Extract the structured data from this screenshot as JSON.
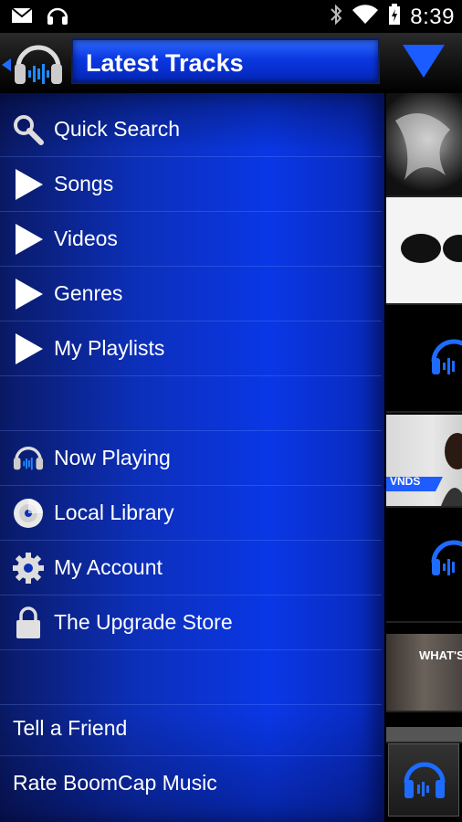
{
  "status_bar": {
    "time": "8:39"
  },
  "action_bar": {
    "title": "Latest Tracks"
  },
  "menu": {
    "items": [
      {
        "label": "Quick Search",
        "icon": "search-icon"
      },
      {
        "label": "Songs",
        "icon": "play-icon"
      },
      {
        "label": "Videos",
        "icon": "play-icon"
      },
      {
        "label": "Genres",
        "icon": "play-icon"
      },
      {
        "label": "My Playlists",
        "icon": "play-icon"
      },
      {
        "label": "Now Playing",
        "icon": "headphones-icon"
      },
      {
        "label": "Local Library",
        "icon": "disc-icon"
      },
      {
        "label": "My Account",
        "icon": "gear-icon"
      },
      {
        "label": "The Upgrade Store",
        "icon": "lock-icon"
      },
      {
        "label": "Tell a Friend"
      },
      {
        "label": "Rate BoomCap Music"
      }
    ]
  },
  "thumbnails": {
    "t4_text": "VNDS",
    "t6_text": "WHAT'S"
  },
  "colors": {
    "accent": "#0a37e6",
    "icon_blue": "#1e6bff"
  }
}
